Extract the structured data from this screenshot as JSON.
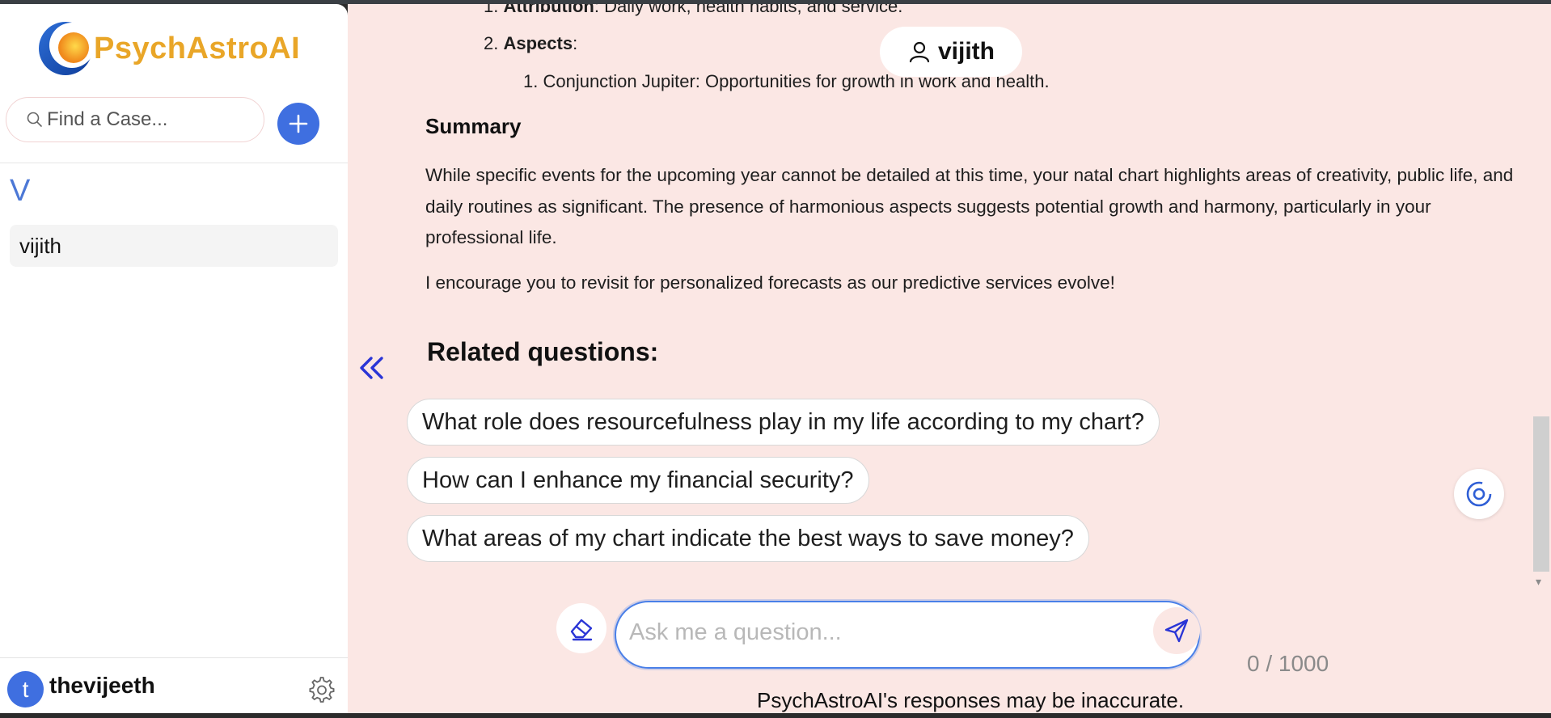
{
  "app": {
    "name": "PsychAstroAI",
    "brand_color": "#e9a628",
    "accent_color": "#3f6fe0"
  },
  "sidebar": {
    "search_placeholder": "Find a Case...",
    "add_icon": "plus-icon",
    "group_letter": "V",
    "cases": [
      {
        "label": "vijith"
      }
    ],
    "footer": {
      "avatar_initial": "t",
      "username": "thevijeeth",
      "settings_icon": "gear-icon"
    }
  },
  "main": {
    "active_case": "vijith",
    "list_top": {
      "item1_bold": "Attribution",
      "item1_rest": ": Daily work, health habits, and service.",
      "item2_label": "Aspects",
      "item2_colon": ":",
      "sub_item": "Conjunction Jupiter: Opportunities for growth in work and health."
    },
    "summary_heading": "Summary",
    "summary_paragraph": "While specific events for the upcoming year cannot be detailed at this time, your natal chart highlights areas of creativity, public life, and daily routines as significant. The presence of harmonious aspects suggests potential growth and harmony, particularly in your professional life.",
    "closing_paragraph": "I encourage you to revisit for personalized forecasts as our predictive services evolve!",
    "related_heading": "Related questions:",
    "related_questions": [
      "What role does resourcefulness play in my life according to my chart?",
      "How can I enhance my financial security?",
      "What areas of my chart indicate the best ways to save money?"
    ]
  },
  "composer": {
    "placeholder": "Ask me a question...",
    "value": "",
    "counter": "0 / 1000",
    "disclaimer": "PsychAstroAI's responses may be inaccurate."
  }
}
